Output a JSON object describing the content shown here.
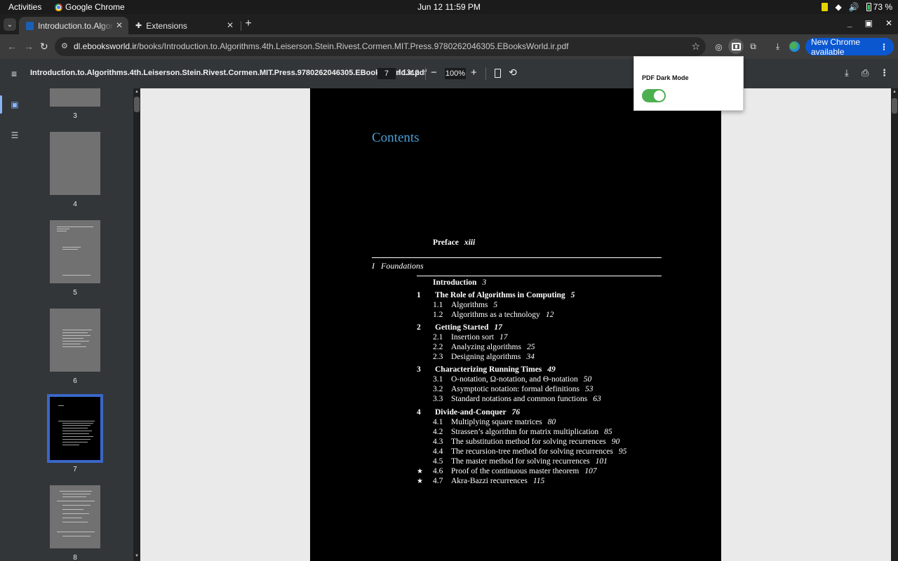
{
  "system_bar": {
    "activities": "Activities",
    "app_name": "Google Chrome",
    "clock": "Jun 12  11:59 PM",
    "battery": "73 %"
  },
  "tabs": [
    {
      "title": "Introduction.to.Algorithms.4th",
      "active": true
    },
    {
      "title": "Extensions",
      "active": false
    }
  ],
  "window_controls": {
    "minimize": "_",
    "maximize": "▣",
    "close": "✕"
  },
  "toolbar": {
    "url_host": "dl.ebooksworld.ir",
    "url_path": "/books/Introduction.to.Algorithms.4th.Leiserson.Stein.Rivest.Cormen.MIT.Press.9780262046305.EBooksWorld.ir.pdf",
    "update_label": "New Chrome available"
  },
  "pdf_toolbar": {
    "title": "Introduction.to.Algorithms.4th.Leiserson.Stein.Rivest.Cormen.MIT.Press.9780262046305.EBooksWorld.ir.pdf",
    "page_current": "7",
    "page_total": "/ 1312",
    "zoom": "100%"
  },
  "thumbnails": [
    {
      "label": "3"
    },
    {
      "label": "4"
    },
    {
      "label": "5"
    },
    {
      "label": "6"
    },
    {
      "label": "7",
      "selected": true
    },
    {
      "label": "8"
    }
  ],
  "page": {
    "heading": "Contents",
    "preface": {
      "title": "Preface",
      "page": "xiii"
    },
    "part": {
      "num": "I",
      "title": "Foundations"
    },
    "introduction": {
      "title": "Introduction",
      "page": "3"
    },
    "chapters": [
      {
        "num": "1",
        "title": "The Role of Algorithms in Computing",
        "page": "5",
        "sections": [
          {
            "num": "1.1",
            "title": "Algorithms",
            "page": "5"
          },
          {
            "num": "1.2",
            "title": "Algorithms as a technology",
            "page": "12"
          }
        ]
      },
      {
        "num": "2",
        "title": "Getting Started",
        "page": "17",
        "sections": [
          {
            "num": "2.1",
            "title": "Insertion sort",
            "page": "17"
          },
          {
            "num": "2.2",
            "title": "Analyzing algorithms",
            "page": "25"
          },
          {
            "num": "2.3",
            "title": "Designing algorithms",
            "page": "34"
          }
        ]
      },
      {
        "num": "3",
        "title": "Characterizing Running Times",
        "page": "49",
        "sections": [
          {
            "num": "3.1",
            "title": "O-notation, Ω-notation, and Θ-notation",
            "page": "50"
          },
          {
            "num": "3.2",
            "title": "Asymptotic notation: formal definitions",
            "page": "53"
          },
          {
            "num": "3.3",
            "title": "Standard notations and common functions",
            "page": "63"
          }
        ]
      },
      {
        "num": "4",
        "title": "Divide-and-Conquer",
        "page": "76",
        "sections": [
          {
            "num": "4.1",
            "title": "Multiplying square matrices",
            "page": "80"
          },
          {
            "num": "4.2",
            "title": "Strassen’s algorithm for matrix multiplication",
            "page": "85"
          },
          {
            "num": "4.3",
            "title": "The substitution method for solving recurrences",
            "page": "90"
          },
          {
            "num": "4.4",
            "title": "The recursion-tree method for solving recurrences",
            "page": "95"
          },
          {
            "num": "4.5",
            "title": "The master method for solving recurrences",
            "page": "101"
          },
          {
            "num": "4.6",
            "title": "Proof of the continuous master theorem",
            "page": "107",
            "starred": true
          },
          {
            "num": "4.7",
            "title": "Akra-Bazzi recurrences",
            "page": "115",
            "starred": true
          }
        ]
      }
    ]
  },
  "popup": {
    "label": "PDF Dark Mode",
    "enabled": true
  },
  "colors": {
    "accent_blue": "#0b57d0",
    "toggle_on": "#4caf50",
    "heading_blue": "#4a9fd8",
    "thumb_selected": "#3a67c8"
  }
}
